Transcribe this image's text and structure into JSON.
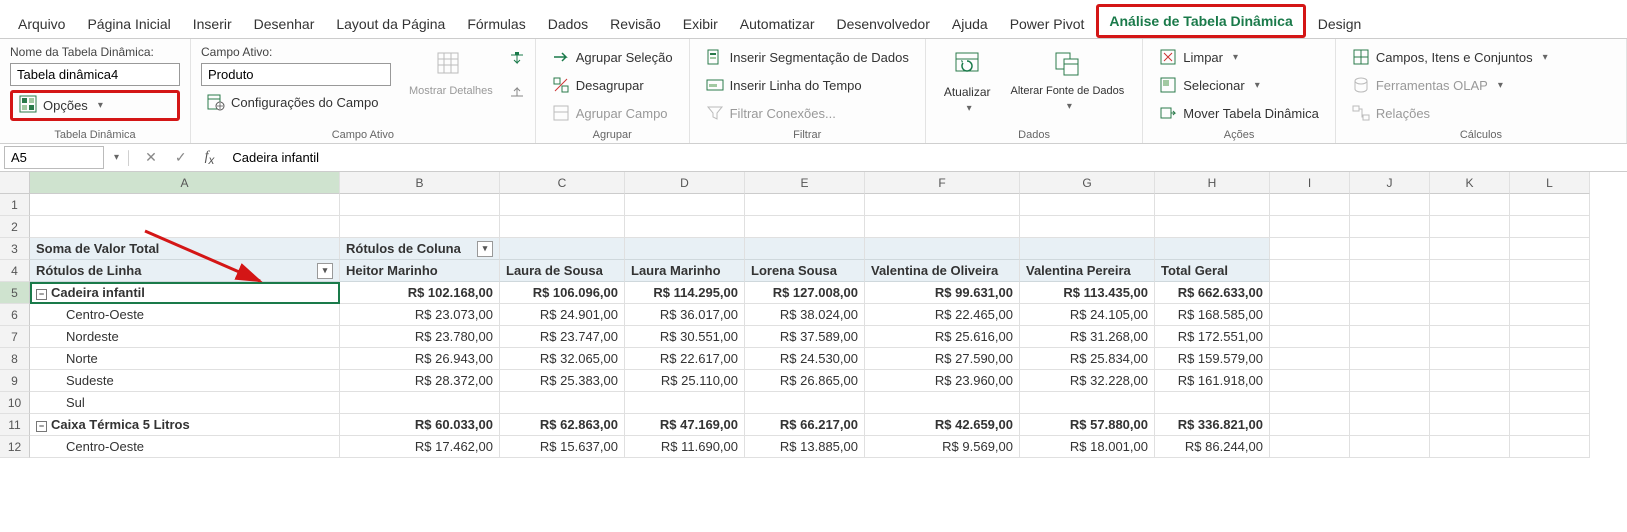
{
  "tabs": [
    "Arquivo",
    "Página Inicial",
    "Inserir",
    "Desenhar",
    "Layout da Página",
    "Fórmulas",
    "Dados",
    "Revisão",
    "Exibir",
    "Automatizar",
    "Desenvolvedor",
    "Ajuda",
    "Power Pivot",
    "Análise de Tabela Dinâmica",
    "Design"
  ],
  "active_tab_index": 13,
  "ribbon": {
    "tabela_dinamica": {
      "label": "Tabela Dinâmica",
      "name_label": "Nome da Tabela Dinâmica:",
      "name_value": "Tabela dinâmica4",
      "opcoes": "Opções"
    },
    "campo_ativo": {
      "label": "Campo Ativo",
      "field_label": "Campo Ativo:",
      "field_value": "Produto",
      "configuracoes": "Configurações do Campo",
      "mostrar_detalhes": "Mostrar Detalhes"
    },
    "agrupar": {
      "label": "Agrupar",
      "agrupar_selecao": "Agrupar Seleção",
      "desagrupar": "Desagrupar",
      "agrupar_campo": "Agrupar Campo"
    },
    "filtrar": {
      "label": "Filtrar",
      "inserir_segmentacao": "Inserir Segmentação de Dados",
      "inserir_linha_tempo": "Inserir Linha do Tempo",
      "filtrar_conexoes": "Filtrar Conexões..."
    },
    "dados": {
      "label": "Dados",
      "atualizar": "Atualizar",
      "alterar_fonte": "Alterar Fonte de Dados"
    },
    "acoes": {
      "label": "Ações",
      "limpar": "Limpar",
      "selecionar": "Selecionar",
      "mover": "Mover Tabela Dinâmica"
    },
    "calculos": {
      "label": "Cálculos",
      "campos": "Campos, Itens e Conjuntos",
      "olap": "Ferramentas OLAP",
      "relacoes": "Relações"
    }
  },
  "formula_bar": {
    "cell_ref": "A5",
    "formula": "Cadeira infantil"
  },
  "columns": [
    "A",
    "B",
    "C",
    "D",
    "E",
    "F",
    "G",
    "H",
    "I",
    "J",
    "K",
    "L"
  ],
  "pivot": {
    "value_header": "Soma de Valor Total",
    "col_label_header": "Rótulos de Coluna",
    "row_label_header": "Rótulos de Linha",
    "col_labels": [
      "Heitor Marinho",
      "Laura de Sousa",
      "Laura Marinho",
      "Lorena Sousa",
      "Valentina de Oliveira",
      "Valentina Pereira",
      "Total Geral"
    ]
  },
  "chart_data": {
    "type": "table",
    "rows": [
      {
        "label": "Cadeira infantil",
        "level": 0,
        "values": [
          "R$ 102.168,00",
          "R$ 106.096,00",
          "R$ 114.295,00",
          "R$ 127.008,00",
          "R$ 99.631,00",
          "R$ 113.435,00",
          "R$ 662.633,00"
        ]
      },
      {
        "label": "Centro-Oeste",
        "level": 1,
        "values": [
          "R$ 23.073,00",
          "R$ 24.901,00",
          "R$ 36.017,00",
          "R$ 38.024,00",
          "R$ 22.465,00",
          "R$ 24.105,00",
          "R$ 168.585,00"
        ]
      },
      {
        "label": "Nordeste",
        "level": 1,
        "values": [
          "R$ 23.780,00",
          "R$ 23.747,00",
          "R$ 30.551,00",
          "R$ 37.589,00",
          "R$ 25.616,00",
          "R$ 31.268,00",
          "R$ 172.551,00"
        ]
      },
      {
        "label": "Norte",
        "level": 1,
        "values": [
          "R$ 26.943,00",
          "R$ 32.065,00",
          "R$ 22.617,00",
          "R$ 24.530,00",
          "R$ 27.590,00",
          "R$ 25.834,00",
          "R$ 159.579,00"
        ]
      },
      {
        "label": "Sudeste",
        "level": 1,
        "values": [
          "R$ 28.372,00",
          "R$ 25.383,00",
          "R$ 25.110,00",
          "R$ 26.865,00",
          "R$ 23.960,00",
          "R$ 32.228,00",
          "R$ 161.918,00"
        ]
      },
      {
        "label": "Sul",
        "level": 1,
        "values": [
          "",
          "",
          "",
          "",
          "",
          "",
          ""
        ]
      },
      {
        "label": "Caixa Térmica 5 Litros",
        "level": 0,
        "values": [
          "R$ 60.033,00",
          "R$ 62.863,00",
          "R$ 47.169,00",
          "R$ 66.217,00",
          "R$ 42.659,00",
          "R$ 57.880,00",
          "R$ 336.821,00"
        ]
      },
      {
        "label": "Centro-Oeste",
        "level": 1,
        "values": [
          "R$ 17.462,00",
          "R$ 15.637,00",
          "R$ 11.690,00",
          "R$ 13.885,00",
          "R$ 9.569,00",
          "R$ 18.001,00",
          "R$ 86.244,00"
        ]
      }
    ]
  }
}
